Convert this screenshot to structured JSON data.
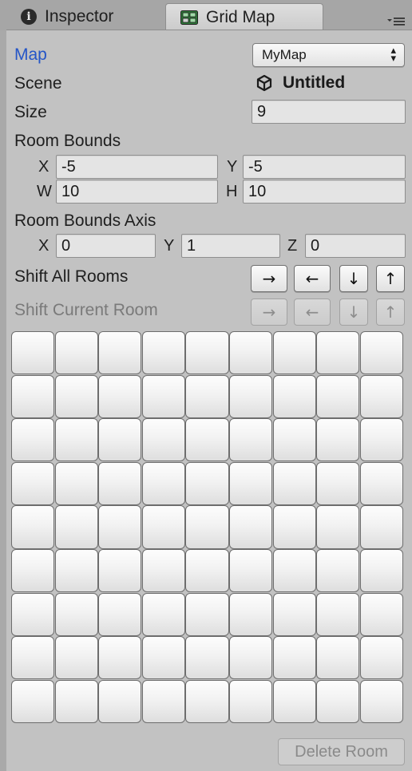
{
  "tabs": [
    {
      "label": "Inspector",
      "icon": "info-icon"
    },
    {
      "label": "Grid Map",
      "icon": "map-icon",
      "active": true
    }
  ],
  "fields": {
    "map": {
      "label": "Map",
      "value": "MyMap"
    },
    "scene": {
      "label": "Scene",
      "value": "Untitled"
    },
    "size": {
      "label": "Size",
      "value": "9"
    },
    "room_bounds": {
      "label": "Room Bounds",
      "x_label": "X",
      "x": "-5",
      "y_label": "Y",
      "y": "-5",
      "w_label": "W",
      "w": "10",
      "h_label": "H",
      "h": "10"
    },
    "room_bounds_axis": {
      "label": "Room Bounds Axis",
      "x_label": "X",
      "x": "0",
      "y_label": "Y",
      "y": "1",
      "z_label": "Z",
      "z": "0"
    }
  },
  "shift_all": {
    "label": "Shift All Rooms",
    "arrows": [
      "→",
      "←",
      "↓",
      "↑"
    ]
  },
  "shift_current": {
    "label": "Shift Current Room",
    "arrows": [
      "→",
      "←",
      "↓",
      "↑"
    ]
  },
  "grid": {
    "rows": 9,
    "cols": 9
  },
  "delete_room_label": "Delete Room",
  "colors": {
    "accent_label": "#2455c7",
    "panel": "#c2c2c2",
    "disabled_text": "#7a7a7a"
  }
}
